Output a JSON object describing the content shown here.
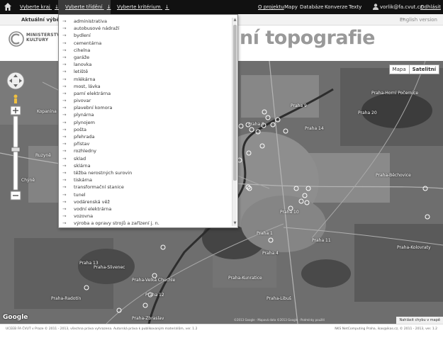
{
  "topbar": {
    "nav": [
      {
        "label": "Vyberte kraj",
        "arrow": "↓"
      },
      {
        "label": "Vyberte třídění",
        "arrow": "↓"
      },
      {
        "label": "Vyberte kritérium",
        "arrow": "↓"
      }
    ],
    "links": [
      "O projektu",
      "Mapy",
      "Databáze",
      "Konverze",
      "Texty"
    ],
    "user": "vorlik@fa.cvut.cz",
    "logout": "Odhlásit"
  },
  "subbar": {
    "current_label": "Aktuální výběr:",
    "english": "English version"
  },
  "header": {
    "logo_line1": "MINISTERSTVO",
    "logo_line2": "KULTURY",
    "title": "ní topografie"
  },
  "dropdown": {
    "arrow": "→",
    "items": [
      "administrativa",
      "autobusové nádraží",
      "bydlení",
      "cementárna",
      "cihelna",
      "garáže",
      "lanovka",
      "letiště",
      "mlékárna",
      "most, lávka",
      "parní elektrárna",
      "pivovar",
      "plavební komora",
      "plynárna",
      "plynojem",
      "pošta",
      "přehrada",
      "přístav",
      "rozhledny",
      "sklad",
      "sklárna",
      "těžba nerostných surovin",
      "tiskárna",
      "transformační stanice",
      "tunel",
      "vodárenská věž",
      "vodní elektrárna",
      "vozovna",
      "výroba a opravy strojů a zařízení j. n."
    ]
  },
  "map": {
    "type_map": "Mapa",
    "type_satellite": "Satelitní",
    "places": [
      "Praha 14",
      "Praha 20",
      "Praha 9",
      "Praha 8",
      "Praha 1",
      "Praha 10",
      "Praha 11",
      "Praha 4",
      "Praha 12",
      "Praha-Slivenec",
      "Praha-Velká Chuchle",
      "Praha-Kunratice",
      "Praha-Libuš",
      "Praha-Zbraslav",
      "Praha-Radotín",
      "Praha-Horní Počernice",
      "Praha-Běchovice",
      "Praha-Kolovraty",
      "Kopanina",
      "Chýně",
      "Ruzyně",
      "Praha 13"
    ],
    "footer": "©2013 Google · Mapová data ©2013 Google · Podmínky použití",
    "report": "Nahlásit chybu v mapě",
    "google": "Google"
  },
  "footer": {
    "left": "UCEEB FA ČVUT v Praze © 2011 - 2013, všechna práva vyhrazena. Autorská práva k publikovaným materiálům, ver. 1.2",
    "right": "NKS NetComputing Praha, ikas@ikas.cz, © 2011 - 2013, ver. 1.2"
  },
  "colors": {
    "topbar_bg": "#111111",
    "active_nav_bg": "#3a3a3a",
    "title_gray": "#999999"
  }
}
